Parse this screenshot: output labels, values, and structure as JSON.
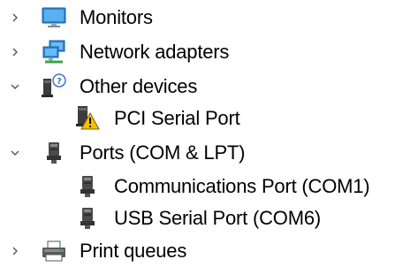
{
  "tree": {
    "items": [
      {
        "label": "Monitors",
        "expanded": false,
        "icon": "monitor-icon"
      },
      {
        "label": "Network adapters",
        "expanded": false,
        "icon": "network-adapter-icon"
      },
      {
        "label": "Other devices",
        "expanded": true,
        "icon": "unknown-device-icon"
      },
      {
        "label": "PCI Serial Port",
        "icon": "warning-device-icon"
      },
      {
        "label": "Ports (COM & LPT)",
        "expanded": true,
        "icon": "port-icon"
      },
      {
        "label": "Communications Port (COM1)",
        "icon": "port-icon"
      },
      {
        "label": "USB Serial Port (COM6)",
        "icon": "port-icon"
      },
      {
        "label": "Print queues",
        "expanded": false,
        "icon": "printer-icon"
      }
    ]
  }
}
